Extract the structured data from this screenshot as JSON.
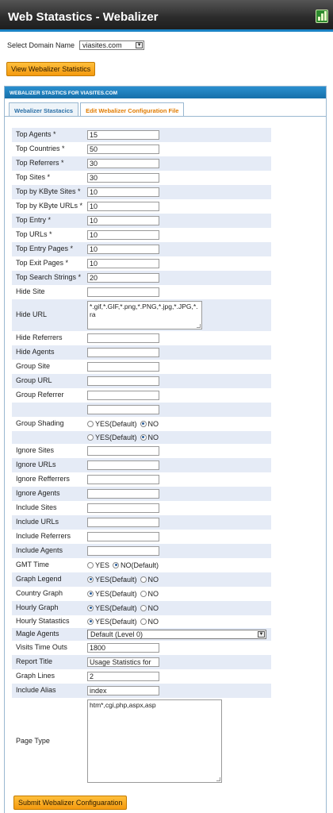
{
  "header": {
    "title": "Web Statastics - Webalizer",
    "logo_icon": "webalizer-chart-icon"
  },
  "domain": {
    "label": "Select Domain Name",
    "value": "viasites.com"
  },
  "view_button": "View Webalizer Statistics",
  "panel": {
    "title": "WEBALIZER STASTICS FOR VIASITES.COM",
    "tabs": [
      "Webalizer Stastacics",
      "Edit Webalizer Configuration File"
    ],
    "active_tab": 1
  },
  "colors": {
    "accent": "#1a82c4",
    "button": "#f5a623",
    "active_tab_text": "#e07b00",
    "row_alt": "#e5ebf6"
  },
  "fields": [
    {
      "label": "Top Agents *",
      "value": "15"
    },
    {
      "label": "Top Countries *",
      "value": "50"
    },
    {
      "label": "Top Referrers *",
      "value": "30"
    },
    {
      "label": "Top Sites *",
      "value": "30"
    },
    {
      "label": "Top by KByte Sites *",
      "value": "10"
    },
    {
      "label": "Top by KByte URLs *",
      "value": "10"
    },
    {
      "label": "Top Entry *",
      "value": "10"
    },
    {
      "label": "Top URLs *",
      "value": "10"
    },
    {
      "label": "Top Entry Pages *",
      "value": "10"
    },
    {
      "label": "Top Exit Pages *",
      "value": "10"
    },
    {
      "label": "Top Search Strings *",
      "value": "20"
    },
    {
      "label": "Hide Site",
      "value": ""
    },
    {
      "label": "Hide URL",
      "value": "*.gif,*.GIF,*.png,*.PNG,*.jpg,*.JPG,*.ra"
    },
    {
      "label": "Hide Referrers",
      "value": ""
    },
    {
      "label": "Hide Agents",
      "value": ""
    },
    {
      "label": "Group Site",
      "value": ""
    },
    {
      "label": "Group URL",
      "value": ""
    },
    {
      "label": "Group Referrer",
      "value": ""
    },
    {
      "label": "",
      "value": ""
    },
    {
      "label": "Group Shading",
      "yes": "YES(Default)",
      "no": "NO",
      "selected": "no"
    },
    {
      "label": "",
      "yes": "YES(Default)",
      "no": "NO",
      "selected": "no"
    },
    {
      "label": "Ignore Sites",
      "value": ""
    },
    {
      "label": "Ignore URLs",
      "value": ""
    },
    {
      "label": "Ignore Refferrers",
      "value": ""
    },
    {
      "label": "Ignore Agents",
      "value": ""
    },
    {
      "label": "Include Sites",
      "value": ""
    },
    {
      "label": "Include URLs",
      "value": ""
    },
    {
      "label": "Include Referrers",
      "value": ""
    },
    {
      "label": "Include Agents",
      "value": ""
    },
    {
      "label": "GMT Time",
      "yes": "YES",
      "no": "NO(Default)",
      "selected": "no"
    },
    {
      "label": "Graph Legend",
      "yes": "YES(Default)",
      "no": "NO",
      "selected": "yes"
    },
    {
      "label": "Country Graph",
      "yes": "YES(Default)",
      "no": "NO",
      "selected": "yes"
    },
    {
      "label": "Hourly Graph",
      "yes": "YES(Default)",
      "no": "NO",
      "selected": "yes"
    },
    {
      "label": "Hourly Statastics",
      "yes": "YES(Default)",
      "no": "NO",
      "selected": "yes"
    },
    {
      "label": "Magle Agents",
      "value": "Default (Level 0)"
    },
    {
      "label": "Visits Time Outs",
      "value": "1800"
    },
    {
      "label": "Report Title",
      "value": "Usage Statistics for"
    },
    {
      "label": "Graph Lines",
      "value": "2"
    },
    {
      "label": "Include Alias",
      "value": "index"
    },
    {
      "label": "Page Type",
      "value": "htm*,cgi,php,aspx,asp"
    }
  ],
  "submit_button": "Submit Webalizer Configuaration"
}
